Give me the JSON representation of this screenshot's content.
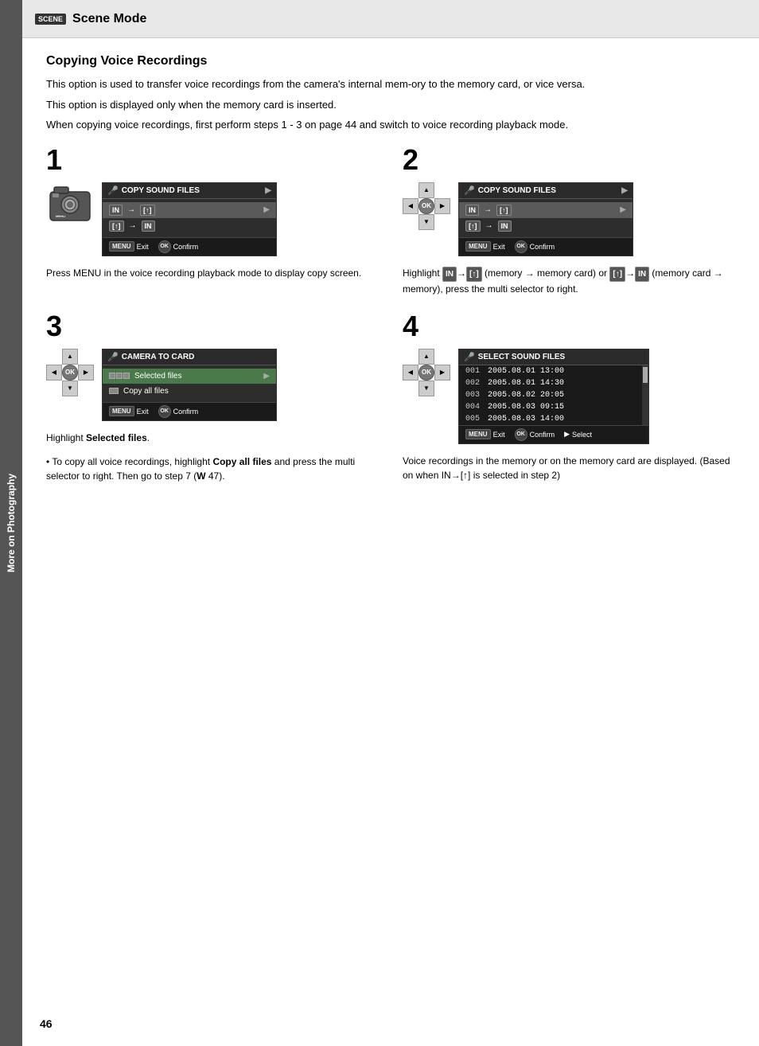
{
  "sidebar": {
    "label": "More on Photography"
  },
  "header": {
    "icon_label": "SCENE",
    "title": "Scene Mode"
  },
  "page": {
    "number": "46",
    "section_title": "Copying Voice Recordings",
    "intro": [
      "This option is used to transfer voice recordings from the camera's internal mem-ory to the memory card, or vice versa.",
      "This option is displayed only when the memory card is inserted.",
      "When copying voice recordings, first perform steps 1 - 3 on page 44 and switch to voice recording playback mode."
    ]
  },
  "steps": [
    {
      "number": "1",
      "screen_title": "COPY SOUND FILES",
      "rows": [
        {
          "label": "IN→[↑]",
          "selected": true
        },
        {
          "label": "[↑]→IN",
          "selected": false
        }
      ],
      "footer": {
        "exit": "Exit",
        "confirm": "Confirm"
      },
      "description": "Press MENU in the voice recording playback mode to display copy screen."
    },
    {
      "number": "2",
      "screen_title": "COPY SOUND FILES",
      "rows": [
        {
          "label": "IN→[↑]",
          "selected": true
        },
        {
          "label": "[↑]→IN",
          "selected": false
        }
      ],
      "footer": {
        "exit": "Exit",
        "confirm": "Confirm"
      },
      "description": "Highlight IN→[↑] (memory → memory card) or [↑]→IN (memory card → memory), press the multi selector to right."
    },
    {
      "number": "3",
      "screen_title": "CAMERA TO CARD",
      "rows": [
        {
          "label": "Selected files",
          "selected": true
        },
        {
          "label": "Copy all files",
          "selected": false
        }
      ],
      "footer": {
        "exit": "Exit",
        "confirm": "Confirm"
      },
      "description": "Highlight Selected files.",
      "note": "• To copy all voice recordings, highlight Copy all files and press the multi selector to right. Then go to step 7 (W 47)."
    },
    {
      "number": "4",
      "screen_title": "SELECT SOUND FILES",
      "files": [
        {
          "num": "001",
          "date": "2005.08.01",
          "time": "13:00"
        },
        {
          "num": "002",
          "date": "2005.08.01",
          "time": "14:30"
        },
        {
          "num": "003",
          "date": "2005.08.02",
          "time": "20:05"
        },
        {
          "num": "004",
          "date": "2005.08.03",
          "time": "09:15"
        },
        {
          "num": "005",
          "date": "2005.08.03",
          "time": "14:00"
        }
      ],
      "footer": {
        "exit": "Exit",
        "confirm": "Confirm",
        "select": "Select"
      },
      "description": "Voice recordings in the memory or on the memory card are displayed. (Based on when IN→[↑] is selected in step 2)"
    }
  ]
}
